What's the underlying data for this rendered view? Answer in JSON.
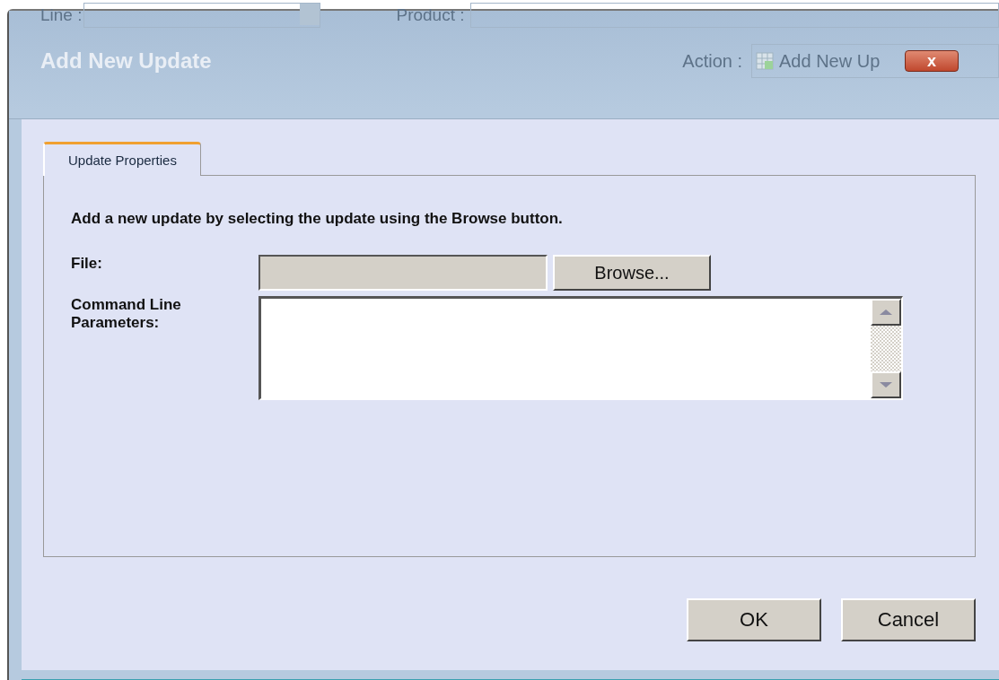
{
  "background": {
    "line_label": "Line :",
    "product_label": "Product :",
    "action_label": "Action :",
    "action_value": "Add New Up"
  },
  "dialog": {
    "title": "Add New Update",
    "close": "x"
  },
  "tabs": [
    {
      "label": "Update Properties",
      "selected": true
    }
  ],
  "instructions": "Add a new update by selecting the update using the Browse button.",
  "fields": [
    {
      "kind": "file",
      "label": "File:",
      "button": "Browse..."
    },
    {
      "kind": "textarea",
      "label": "Command Line Parameters:"
    }
  ],
  "buttons": [
    "OK",
    "Cancel"
  ]
}
